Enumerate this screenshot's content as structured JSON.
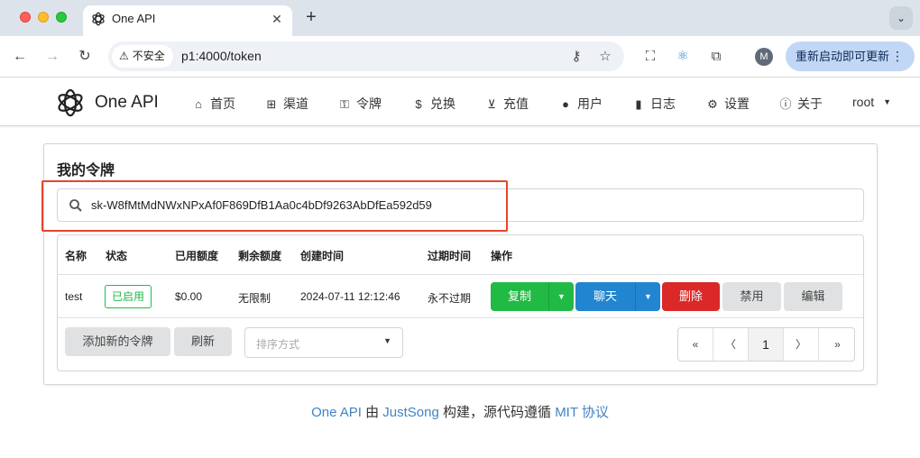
{
  "browser": {
    "tab_title": "One API",
    "insecure_label": "不安全",
    "url": "p1:4000/token",
    "update_button": "重新启动即可更新",
    "profile_initial": "M"
  },
  "app": {
    "brand": "One API",
    "nav": [
      {
        "label": "首页",
        "icon": "home-icon"
      },
      {
        "label": "渠道",
        "icon": "sitemap-icon"
      },
      {
        "label": "令牌",
        "icon": "key-icon"
      },
      {
        "label": "兑换",
        "icon": "dollar-icon"
      },
      {
        "label": "充值",
        "icon": "cart-icon"
      },
      {
        "label": "用户",
        "icon": "user-icon"
      },
      {
        "label": "日志",
        "icon": "book-icon"
      },
      {
        "label": "设置",
        "icon": "gear-icon"
      },
      {
        "label": "关于",
        "icon": "info-icon"
      }
    ],
    "user": "root"
  },
  "page": {
    "title": "我的令牌",
    "search_value": "sk-W8fMtMdNWxNPxAf0F869DfB1Aa0c4bDf9263AbDfEa592d59",
    "highlight_color": "#e8432c"
  },
  "table": {
    "headers": [
      "名称",
      "状态",
      "已用额度",
      "剩余额度",
      "创建时间",
      "过期时间",
      "操作"
    ],
    "rows": [
      {
        "name": "test",
        "status": "已启用",
        "used": "$0.00",
        "remaining": "无限制",
        "created": "2024-07-11 12:12:46",
        "expires": "永不过期",
        "actions": {
          "copy": "复制",
          "chat": "聊天",
          "delete": "删除",
          "disable": "禁用",
          "edit": "编辑"
        }
      }
    ],
    "add_button": "添加新的令牌",
    "refresh_button": "刷新",
    "sort_placeholder": "排序方式",
    "pagination": {
      "first": "«",
      "prev": "〈",
      "current": "1",
      "next": "〉",
      "last": "»"
    }
  },
  "footer": {
    "part1": "One API",
    "part2": " 由 ",
    "part3": "JustSong",
    "part4": " 构建，源代码遵循 ",
    "part5": "MIT 协议"
  },
  "colors": {
    "green": "#21ba45",
    "blue": "#2185d0",
    "red": "#db2828",
    "grey": "#e0e1e2",
    "link": "#4183c4"
  }
}
